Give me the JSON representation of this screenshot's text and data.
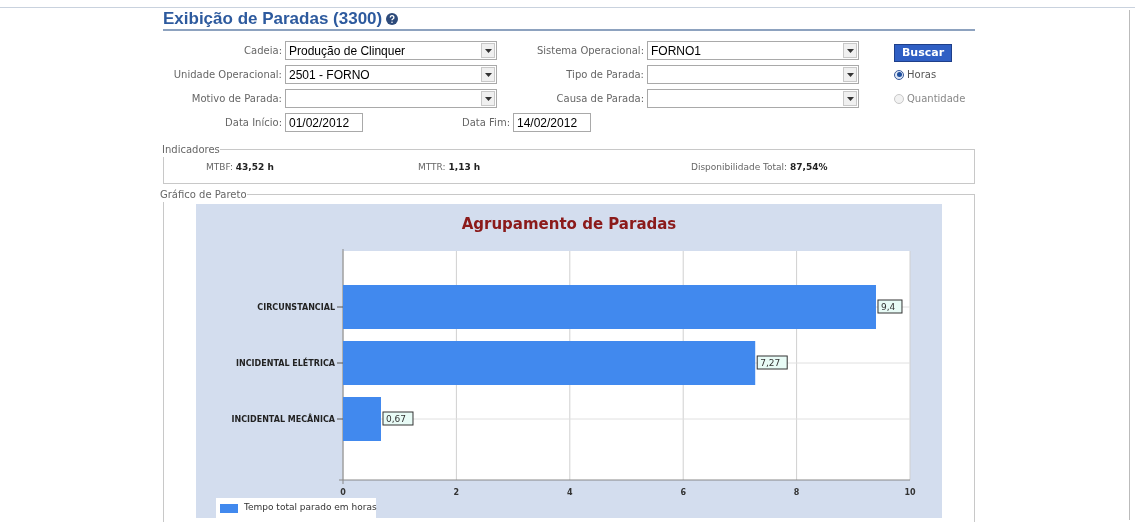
{
  "page": {
    "title": "Exibição de Paradas (3300)"
  },
  "filters_left": [
    {
      "label": "Cadeia:",
      "value": "Produção de Clinquer",
      "kind": "select"
    },
    {
      "label": "Unidade Operacional:",
      "value": "2501 - FORNO",
      "kind": "select"
    },
    {
      "label": "Motivo de Parada:",
      "kind": "select"
    },
    {
      "label": "Data Início:",
      "value": "01/02/2012",
      "kind": "date"
    }
  ],
  "filters_right": [
    {
      "label": "Sistema Operacional:",
      "value": "FORNO1",
      "kind": "select"
    },
    {
      "label": "Tipo de Parada:",
      "kind": "select"
    },
    {
      "label": "Causa de Parada:",
      "kind": "select"
    },
    {
      "label": "Data Fim:",
      "value": "14/02/2012",
      "kind": "date"
    }
  ],
  "search_button": "Buscar",
  "mode_options": [
    {
      "label": "Horas",
      "selected": true
    },
    {
      "label": "Quantidade",
      "selected": false
    }
  ],
  "indicators": {
    "legend": "Indicadores",
    "items": [
      {
        "label": "MTBF:",
        "value": "43,52 h"
      },
      {
        "label": "MTTR:",
        "value": "1,13 h"
      },
      {
        "label": "Disponibilidade Total:",
        "value": "87,54%"
      }
    ]
  },
  "pareto": {
    "legend": "Gráfico de Pareto",
    "chart_data": {
      "type": "bar",
      "orientation": "horizontal",
      "title": "Agrupamento de Paradas",
      "categories": [
        "CIRCUNSTANCIAL",
        "INCIDENTAL ELÉTRICA",
        "INCIDENTAL MECÂNICA"
      ],
      "series": [
        {
          "name": "Tempo total parado em horas",
          "color": "#4189ee",
          "values": [
            9.4,
            7.27,
            0.67
          ]
        }
      ],
      "grid": true,
      "xlim": [
        0,
        10
      ],
      "xticks": [
        0,
        2,
        4,
        6,
        8,
        10
      ],
      "value_labels": [
        "9,4",
        "7,27",
        "0,67"
      ]
    }
  }
}
